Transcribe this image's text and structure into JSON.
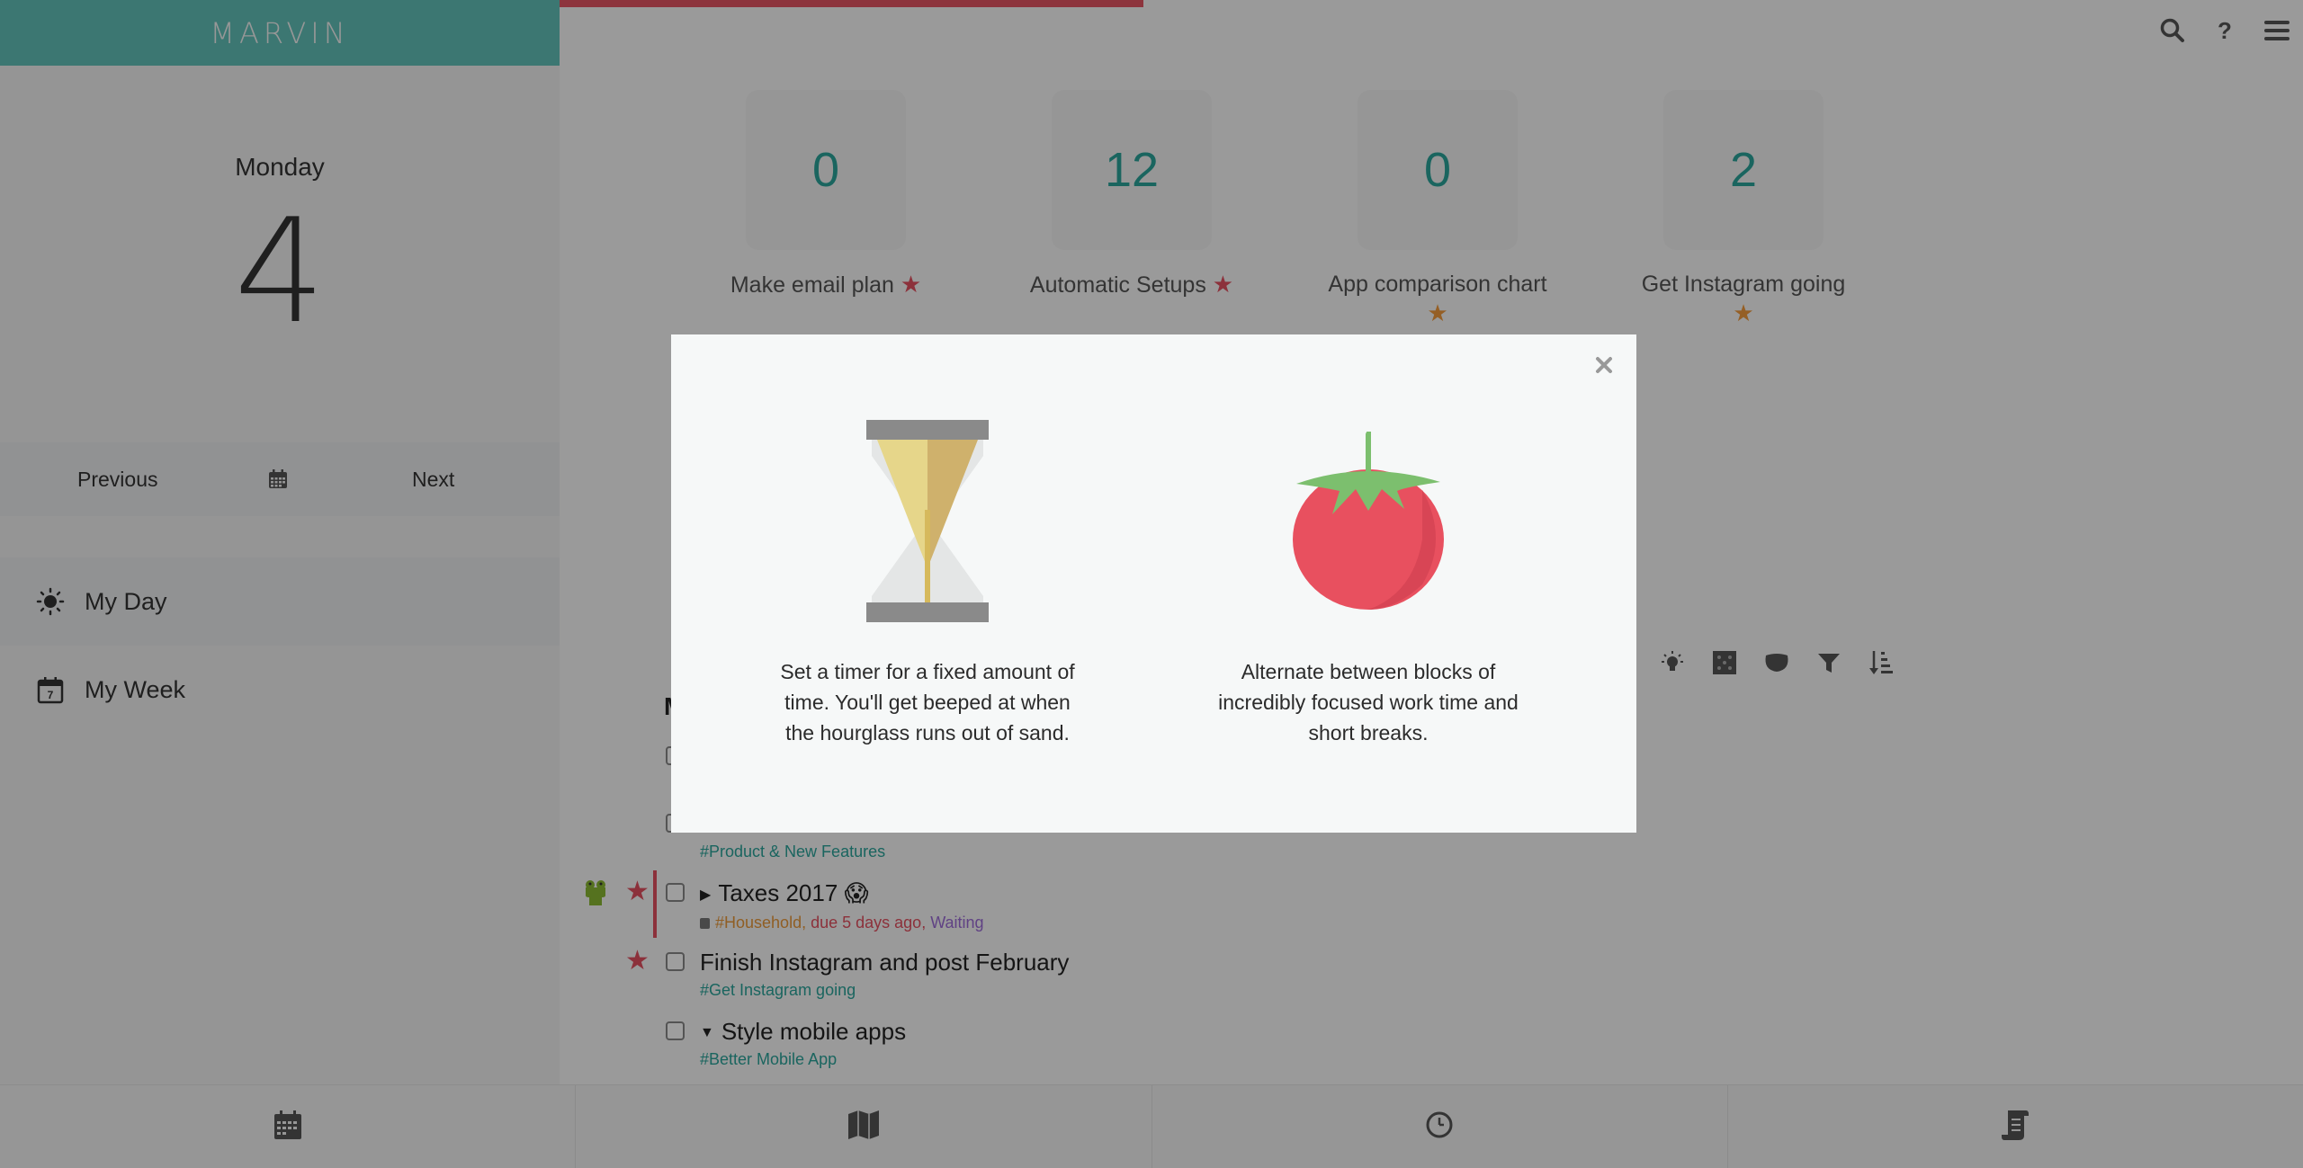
{
  "app": {
    "brand": "MARVIN",
    "progress_percent": 33.5,
    "colors": {
      "brand_teal": "#62c1b9",
      "progress_red": "#e45563",
      "star_red": "#e2505f",
      "star_orange": "#f09a3c",
      "tag_teal": "#2aa39a",
      "tag_orange": "#e8983a",
      "tag_red": "#e2505f",
      "tag_purple": "#9b6bd6"
    }
  },
  "header": {
    "icons": [
      {
        "name": "search-icon"
      },
      {
        "name": "help-icon",
        "glyph": "?"
      },
      {
        "name": "menu-icon"
      }
    ]
  },
  "sidebar": {
    "day_name": "Monday",
    "day_number": "4",
    "nav": {
      "previous": "Previous",
      "next": "Next",
      "calendar_icon": "calendar-icon"
    },
    "items": [
      {
        "label": "My Day",
        "icon": "sun-icon",
        "active": true
      },
      {
        "label": "My Week",
        "icon": "calendar-week-icon",
        "icon_text": "7",
        "active": false
      }
    ]
  },
  "goals": [
    {
      "count": "0",
      "label": "Make email plan",
      "star": "red"
    },
    {
      "count": "12",
      "label": "Automatic Setups",
      "star": "red"
    },
    {
      "count": "0",
      "label": "App comparison chart",
      "star": "orange"
    },
    {
      "count": "2",
      "label": "Get Instagram going",
      "star": "orange"
    }
  ],
  "toolbar": {
    "icons": [
      "lightbulb-icon",
      "dice-icon",
      "bowl-icon",
      "filter-icon",
      "sort-icon"
    ]
  },
  "tasks": {
    "heading_partial": "M",
    "items": [
      {
        "title": "",
        "tags": [
          {
            "text": "#Product & New Features",
            "color": "teal"
          }
        ]
      },
      {
        "title": "Taxes 2017",
        "emoji": "😱",
        "caret": "right",
        "frog": true,
        "starred": true,
        "tags": [
          {
            "text": "#Household,",
            "color": "orange"
          },
          {
            "text": "due 5 days ago,",
            "color": "red"
          },
          {
            "text": "Waiting",
            "color": "purple"
          }
        ]
      },
      {
        "title": "Finish Instagram and post February",
        "starred": true,
        "tags": [
          {
            "text": "#Get Instagram going",
            "color": "teal"
          }
        ]
      },
      {
        "title": "Style mobile apps",
        "caret": "down",
        "tags": [
          {
            "text": "#Better Mobile App",
            "color": "teal"
          }
        ]
      }
    ]
  },
  "bottom_bar": {
    "tabs": [
      {
        "icon": "calendar-icon"
      },
      {
        "icon": "map-icon"
      },
      {
        "icon": "clock-icon"
      },
      {
        "icon": "scroll-icon"
      }
    ]
  },
  "modal": {
    "close_label": "×",
    "options": [
      {
        "name": "timer",
        "art": "hourglass",
        "description": "Set a timer for a fixed amount of time. You'll get beeped at when the hourglass runs out of sand."
      },
      {
        "name": "pomodoro",
        "art": "tomato",
        "description": "Alternate between blocks of incredibly focused work time and short breaks."
      }
    ]
  }
}
